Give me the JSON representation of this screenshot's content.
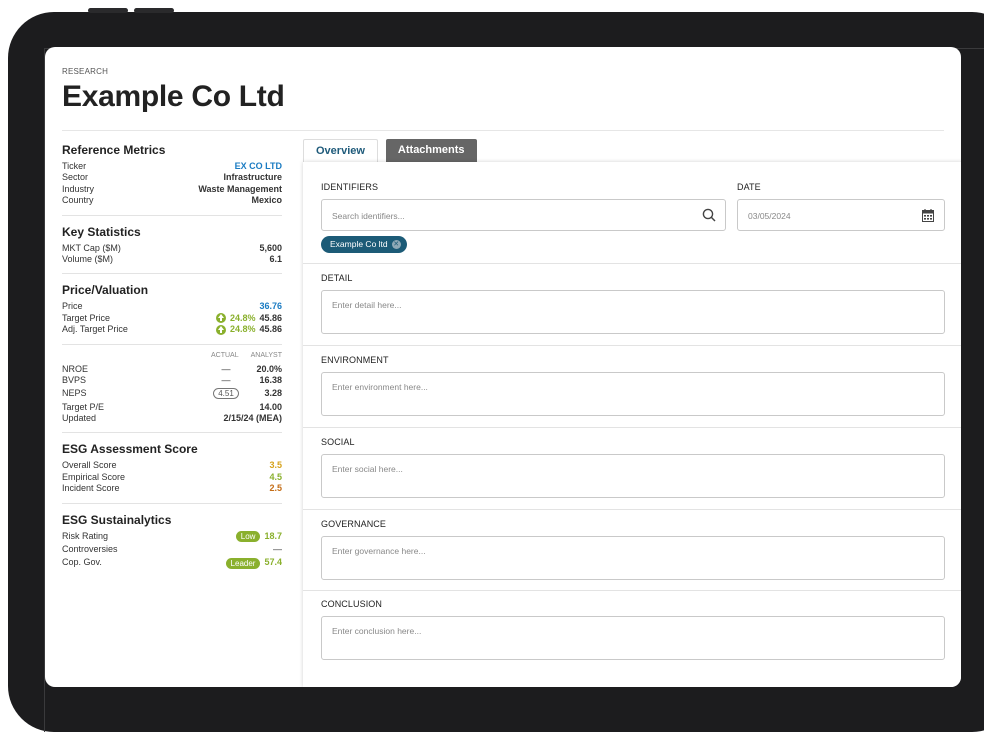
{
  "header": {
    "eyebrow": "RESEARCH",
    "title": "Example Co Ltd"
  },
  "reference_metrics": {
    "title": "Reference Metrics",
    "rows": [
      {
        "label": "Ticker",
        "value": "EX CO LTD"
      },
      {
        "label": "Sector",
        "value": "Infrastructure"
      },
      {
        "label": "Industry",
        "value": "Waste Management"
      },
      {
        "label": "Country",
        "value": "Mexico"
      }
    ]
  },
  "key_statistics": {
    "title": "Key Statistics",
    "rows": [
      {
        "label": "MKT Cap ($M)",
        "value": "5,600"
      },
      {
        "label": "Volume ($M)",
        "value": "6.1"
      }
    ]
  },
  "price_valuation": {
    "title": "Price/Valuation",
    "price": {
      "label": "Price",
      "value": "36.76"
    },
    "target_price": {
      "label": "Target Price",
      "change": "24.8%",
      "value": "45.86"
    },
    "adj_target_price": {
      "label": "Adj. Target Price",
      "change": "24.8%",
      "value": "45.86"
    },
    "col_actual": "ACTUAL",
    "col_analyst": "ANALYST",
    "nroe": {
      "label": "NROE",
      "actual": "—",
      "analyst": "20.0%"
    },
    "bvps": {
      "label": "BVPS",
      "actual": "—",
      "analyst": "16.38"
    },
    "neps": {
      "label": "NEPS",
      "actual": "4.51",
      "analyst": "3.28"
    },
    "target_pe": {
      "label": "Target P/E",
      "value": "14.00"
    },
    "updated": {
      "label": "Updated",
      "value": "2/15/24 (MEA)"
    }
  },
  "esg_assessment": {
    "title": "ESG Assessment Score",
    "overall": {
      "label": "Overall Score",
      "value": "3.5"
    },
    "empirical": {
      "label": "Empirical Score",
      "value": "4.5"
    },
    "incident": {
      "label": "Incident Score",
      "value": "2.5"
    }
  },
  "esg_sustainalytics": {
    "title": "ESG Sustainalytics",
    "risk": {
      "label": "Risk Rating",
      "badge": "Low",
      "value": "18.7"
    },
    "controversies": {
      "label": "Controversies",
      "value": "—"
    },
    "cop_gov": {
      "label": "Cop. Gov.",
      "badge": "Leader",
      "value": "57.4"
    }
  },
  "tabs": {
    "overview": "Overview",
    "attachments": "Attachments"
  },
  "form": {
    "identifiers_label": "IDENTIFIERS",
    "identifiers_placeholder": "Search identifiers...",
    "chip": "Example Co ltd",
    "date_label": "DATE",
    "date_value": "03/05/2024",
    "detail_label": "DETAIL",
    "detail_placeholder": "Enter detail here...",
    "environment_label": "ENVIRONMENT",
    "environment_placeholder": "Enter environment here...",
    "social_label": "SOCIAL",
    "social_placeholder": "Enter social here...",
    "governance_label": "GOVERNANCE",
    "governance_placeholder": "Enter governance here...",
    "conclusion_label": "CONCLUSION",
    "conclusion_placeholder": "Enter conclusion here..."
  },
  "colors": {
    "accent_blue": "#1a7bc2",
    "positive_green": "#8ab02d",
    "score_gold": "#d6a21b",
    "score_orange": "#c46e18",
    "chip_teal": "#1c5b77",
    "tab_inactive": "#666666"
  }
}
